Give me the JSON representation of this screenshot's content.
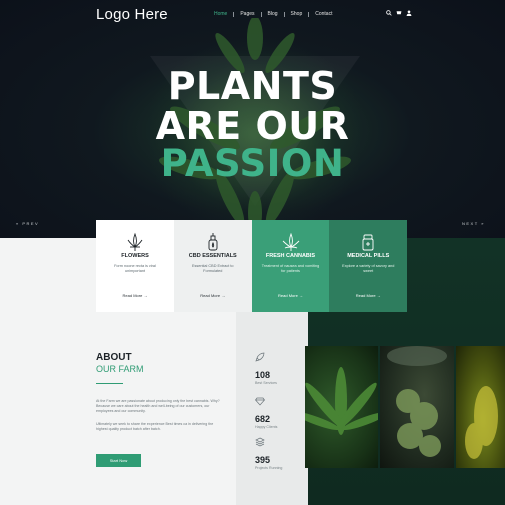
{
  "header": {
    "logo": "Logo Here",
    "nav": [
      {
        "label": "Home",
        "active": true
      },
      {
        "label": "Pages",
        "active": false
      },
      {
        "label": "Blog",
        "active": false
      },
      {
        "label": "Shop",
        "active": false
      },
      {
        "label": "Contact",
        "active": false
      }
    ],
    "icons": [
      "search-icon",
      "cart-icon",
      "user-icon"
    ]
  },
  "hero": {
    "line1": "PLANTS",
    "line2": "ARE OUR",
    "line3": "PASSION",
    "prev": "« PREV",
    "next": "NEXT »"
  },
  "cards": [
    {
      "title": "FLOWERS",
      "text": "Form noone recta is viral unimportant",
      "link": "Read More →",
      "icon": "leaf-icon"
    },
    {
      "title": "CBD ESSENTIALS",
      "text": "Essential CBD Extract to Formulated",
      "link": "Read More →",
      "icon": "oil-bottle-icon"
    },
    {
      "title": "FRESH CANNABIS",
      "text": "Treatment of nausea and vomiting for patients",
      "link": "Read More →",
      "icon": "cannabis-leaf-icon"
    },
    {
      "title": "MEDICAL PILLS",
      "text": "Explore a variety of savory and sweet",
      "link": "Read More →",
      "icon": "pill-bottle-icon"
    }
  ],
  "about": {
    "title": "ABOUT",
    "subtitle": "OUR FARM",
    "paragraph1": "At the Farm we are passionate about producing only the best cannabis. Why? Because we care about the health and well-being of our customers, our employees and our community.",
    "paragraph2": "Ultimately we seek to share the experience Best times ca in delivering the highest quality product batch after batch.",
    "button": "Start Now"
  },
  "stats": [
    {
      "number": "108",
      "label": "Best Services",
      "icon": "rocket-icon"
    },
    {
      "number": "682",
      "label": "Happy Clients",
      "icon": "diamond-icon"
    },
    {
      "number": "395",
      "label": "Projects Running",
      "icon": "layers-icon"
    }
  ],
  "colors": {
    "accent": "#3fb38a",
    "hero_bg": "#0f1620",
    "dark_green": "#123226",
    "card_green": "#3a9f78",
    "card_green_dark": "#2e7d5e"
  }
}
